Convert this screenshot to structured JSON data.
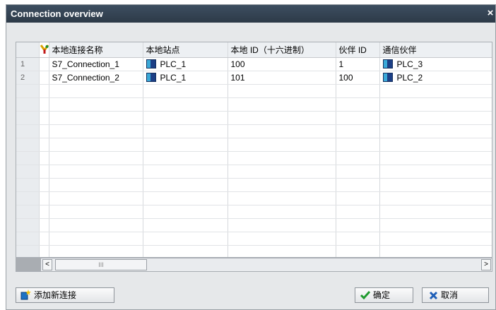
{
  "window": {
    "title": "Connection overview",
    "close_glyph": "×"
  },
  "table": {
    "columns": {
      "local_name": "本地连接名称",
      "local_station": "本地站点",
      "local_id": "本地 ID（十六进制）",
      "partner_id": "伙伴 ID",
      "partner": "通信伙伴"
    },
    "rows": [
      {
        "num": "1",
        "local_name": "S7_Connection_1",
        "local_station": "PLC_1",
        "local_id": "100",
        "partner_id": "1",
        "partner": "PLC_3"
      },
      {
        "num": "2",
        "local_name": "S7_Connection_2",
        "local_station": "PLC_1",
        "local_id": "101",
        "partner_id": "100",
        "partner": "PLC_2"
      }
    ]
  },
  "scrollbar": {
    "left_arrow": "<",
    "right_arrow": ">",
    "thumb_grip": "III"
  },
  "buttons": {
    "add_connection": "添加新连接",
    "ok": "确定",
    "cancel": "取消"
  }
}
